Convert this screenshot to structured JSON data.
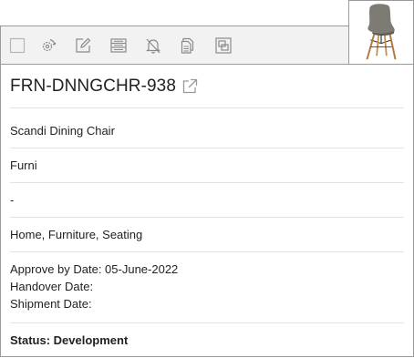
{
  "toolbar": {
    "buttons": [
      {
        "name": "select-checkbox",
        "icon": "checkbox-icon"
      },
      {
        "name": "sync-settings-button",
        "icon": "gear-refresh-icon"
      },
      {
        "name": "edit-button",
        "icon": "edit-icon"
      },
      {
        "name": "list-button",
        "icon": "list-icon"
      },
      {
        "name": "notifications-off-button",
        "icon": "bell-off-icon"
      },
      {
        "name": "copy-button",
        "icon": "copy-icon"
      },
      {
        "name": "resize-button",
        "icon": "resize-icon"
      }
    ]
  },
  "product": {
    "code": "FRN-DNNGCHR-938",
    "name": "Scandi Dining Chair",
    "brand": "Furni",
    "field3": "-",
    "categories": "Home, Furniture, Seating",
    "approve_by": "Approve by Date: 05-June-2022",
    "handover": "Handover Date:",
    "shipment": "Shipment Date:",
    "status": "Status: Development",
    "image_icon": "chair-image"
  }
}
